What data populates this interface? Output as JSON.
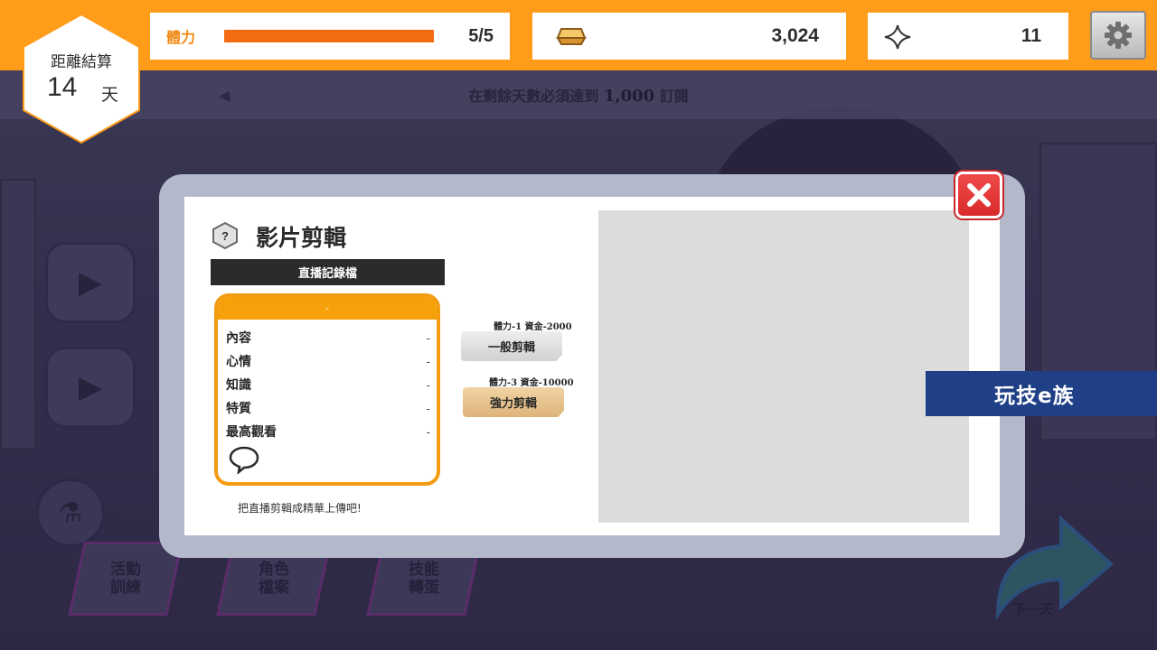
{
  "countdown": {
    "label": "距離結算",
    "days": "14",
    "unit": "天"
  },
  "hud": {
    "stamina": {
      "label": "體力",
      "value": "5/5",
      "fill_fraction": 1.0
    },
    "gold": {
      "icon": "gold-bar-icon",
      "value": "3,024"
    },
    "gems": {
      "icon": "sparkle-star-icon",
      "value": "11"
    },
    "settings_icon": "gear-icon"
  },
  "notice": {
    "prefix": "在剩餘天數必須達到",
    "target": "1,000",
    "suffix": "訂閱"
  },
  "background": {
    "tabs": [
      {
        "label": "活動訓練"
      },
      {
        "label": "角色檔案"
      },
      {
        "label": "技能轉蛋"
      }
    ],
    "next_day": "下一天"
  },
  "modal": {
    "title": "影片剪輯",
    "record_header": "直播記錄檔",
    "card": {
      "header": "-",
      "rows": [
        {
          "label": "內容",
          "value": "-"
        },
        {
          "label": "心情",
          "value": "-"
        },
        {
          "label": "知識",
          "value": "-"
        },
        {
          "label": "特質",
          "value": "-"
        },
        {
          "label": "最高觀看",
          "value": "-"
        }
      ]
    },
    "hint": "把直播剪輯成精華上傳吧!",
    "options": [
      {
        "cost": "體力-1 資金-2000",
        "label": "一般剪輯"
      },
      {
        "cost": "體力-3 資金-10000",
        "label": "強力剪輯"
      }
    ]
  },
  "watermark": "玩技e族",
  "colors": {
    "hud_orange": "#ff9c1a",
    "stamina_fill": "#f26a12",
    "card_border": "#f39c12",
    "close_red": "#e03434",
    "watermark_blue": "#1f3f86"
  }
}
